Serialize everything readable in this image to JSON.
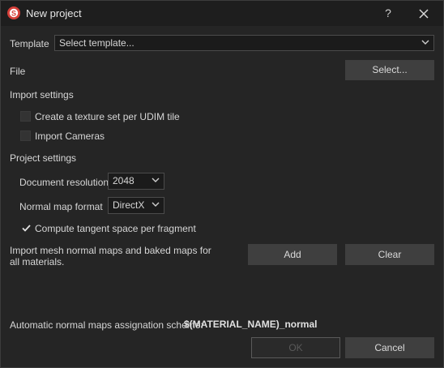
{
  "window": {
    "title": "New project",
    "help_label": "?",
    "icons": {
      "app": "substance-painter-logo-icon",
      "close": "close-icon"
    }
  },
  "template": {
    "label": "Template",
    "value": "Select template..."
  },
  "file": {
    "label": "File",
    "select_button": "Select..."
  },
  "import_settings": {
    "heading": "Import settings",
    "options": [
      {
        "label": "Create a texture set per UDIM tile",
        "checked": false
      },
      {
        "label": "Import Cameras",
        "checked": false
      }
    ]
  },
  "project_settings": {
    "heading": "Project settings",
    "document_resolution": {
      "label": "Document resolution",
      "value": "2048"
    },
    "normal_map_format": {
      "label": "Normal map format",
      "value": "DirectX"
    },
    "compute_tangent": {
      "label": "Compute tangent space per fragment",
      "checked": true
    }
  },
  "import_mesh_maps": {
    "description": "Import mesh normal maps and baked maps for all materials.",
    "add_label": "Add",
    "clear_label": "Clear"
  },
  "assignation": {
    "label": "Automatic normal maps assignation scheme:",
    "value": "$(MATERIAL_NAME)_normal"
  },
  "footer": {
    "ok_label": "OK",
    "cancel_label": "Cancel"
  },
  "colors": {
    "background": "#252525",
    "titlebar": "#1e1e1e",
    "button": "#3f3f3f",
    "accent_red": "#d6403a"
  }
}
